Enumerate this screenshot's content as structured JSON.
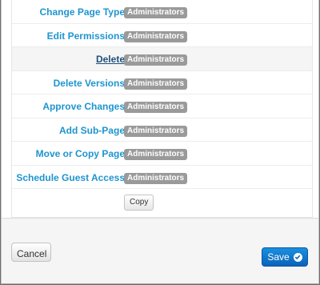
{
  "permissions": [
    {
      "label": "Change Page Type",
      "value": "Administrators"
    },
    {
      "label": "Edit Permissions",
      "value": "Administrators"
    },
    {
      "label": "Delete",
      "value": "Administrators"
    },
    {
      "label": "Delete Versions",
      "value": "Administrators"
    },
    {
      "label": "Approve Changes",
      "value": "Administrators"
    },
    {
      "label": "Add Sub-Page",
      "value": "Administrators"
    },
    {
      "label": "Move or Copy Page",
      "value": "Administrators"
    },
    {
      "label": "Schedule Guest Access",
      "value": "Administrators"
    }
  ],
  "copy_label": "Copy",
  "footer": {
    "cancel_label": "Cancel",
    "save_label": "Save"
  },
  "colors": {
    "label_blue": "#1e95cf",
    "badge_gray": "#9a9a9a",
    "save_blue": "#0b62b9"
  },
  "icons": {
    "save": "check-circle-icon"
  }
}
